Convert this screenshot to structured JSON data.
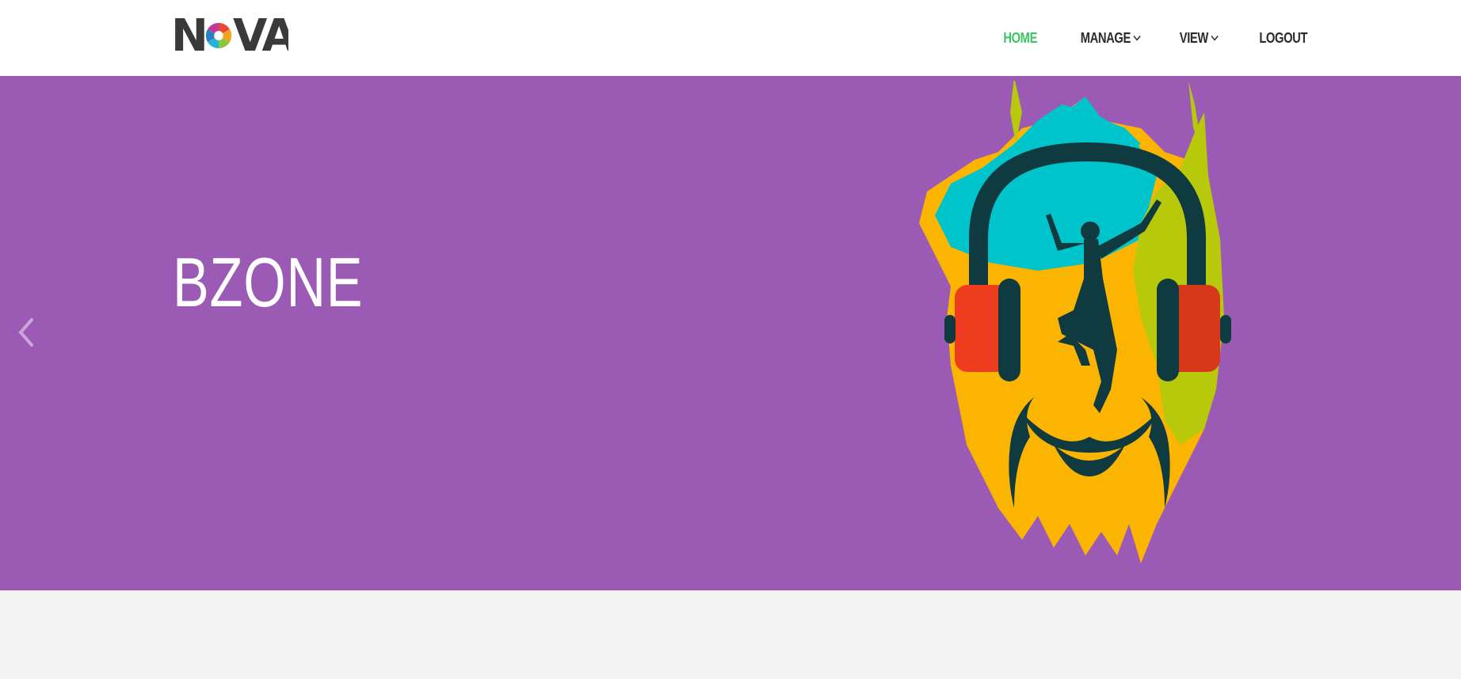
{
  "brand": {
    "logo_text": "NOVA"
  },
  "nav": {
    "items": [
      {
        "label": "HOME",
        "active": true,
        "has_dropdown": false
      },
      {
        "label": "MANAGE",
        "active": false,
        "has_dropdown": true
      },
      {
        "label": "VIEW",
        "active": false,
        "has_dropdown": true
      },
      {
        "label": "LOGOUT",
        "active": false,
        "has_dropdown": false
      }
    ]
  },
  "hero": {
    "title": "BZONE",
    "background_color": "#9b5bb5",
    "image": "headphones-dancer-illustration",
    "prev_icon": "chevron-left-icon"
  },
  "colors": {
    "accent": "#3cc464",
    "nav_text": "#2b2b2b",
    "hero_bg": "#9b5bb5",
    "page_bg": "#f4f4f4"
  }
}
